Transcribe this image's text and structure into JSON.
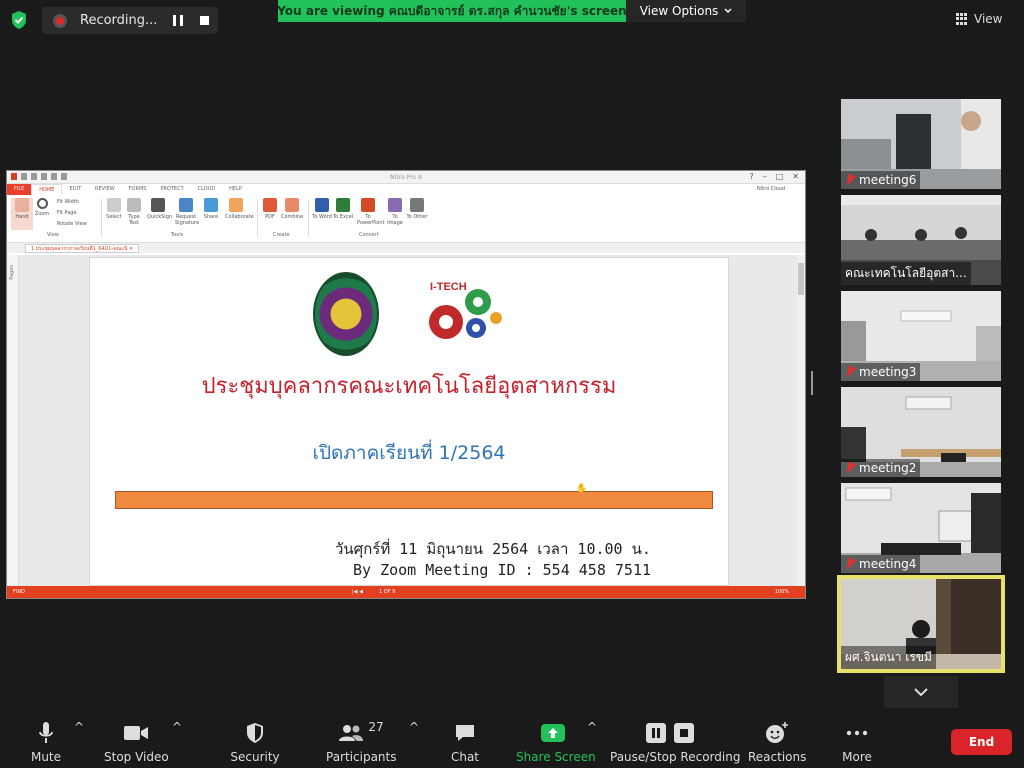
{
  "top": {
    "recording_label": "Recording...",
    "viewing_banner": "You are viewing คณบดีอาจารย์ ดร.สกุล คำนวนชัย's screen",
    "view_options_label": "View Options",
    "view_label": "View"
  },
  "nitro": {
    "window_title": "Nitro Pro 9",
    "tabs": [
      "FILE",
      "HOME",
      "EDIT",
      "REVIEW",
      "FORMS",
      "PROTECT",
      "CLOUD",
      "HELP"
    ],
    "cloud_label": "Nitro Cloud",
    "ribbon": {
      "hand": "Hand",
      "zoom": "Zoom",
      "fit_width": "Fit Width",
      "fit_page": "Fit Page",
      "rotate_view": "Rotate View",
      "view_group": "View",
      "select": "Select",
      "type_text": "Type Text",
      "quicksign": "QuickSign",
      "request_signature": "Request Signature",
      "share": "Share",
      "collaborate": "Collaborate",
      "tools_group": "Tools",
      "pdf": "PDF",
      "combine": "Combine",
      "create_group": "Create",
      "to_word": "To Word",
      "to_excel": "To Excel",
      "to_powerpoint": "To PowerPoint",
      "to_image": "To Image",
      "to_other": "To Other",
      "convert_group": "Convert"
    },
    "doc_tab": "1.ประชุมบุคลากรภาคเรียนที่1_64U1-คณะนี",
    "pages_rail": "Pages",
    "status": {
      "find": "FIND",
      "page_indicator": "1 OF 9",
      "zoom": "100%"
    }
  },
  "document": {
    "title": "ประชุมบุคลากรคณะเทคโนโลยีอุตสาหกรรม",
    "subtitle": "เปิดภาคเรียนที่ 1/2564",
    "date_line": "วันศุกร์ที่ 11 มิถุนายน 2564 เวลา 10.00 น.",
    "zoom_line": "By Zoom Meeting ID : 554 458 7511",
    "logo_text": "I-TECH"
  },
  "gallery": [
    {
      "name": "meeting6",
      "muted": true
    },
    {
      "name": "คณะเทคโนโลยีอุตสา...",
      "muted": false
    },
    {
      "name": "meeting3",
      "muted": true
    },
    {
      "name": "meeting2",
      "muted": true
    },
    {
      "name": "meeting4",
      "muted": true
    },
    {
      "name": "ผศ.จินตนา เรขมี",
      "muted": false
    }
  ],
  "toolbar": {
    "mute": "Mute",
    "stop_video": "Stop Video",
    "security": "Security",
    "participants": "Participants",
    "participants_count": "27",
    "chat": "Chat",
    "share_screen": "Share Screen",
    "pause_stop_recording": "Pause/Stop Recording",
    "reactions": "Reactions",
    "more": "More",
    "end": "End"
  },
  "colors": {
    "share_green": "#23c15a",
    "end_red": "#d9252a",
    "nitro_orange": "#e2401f",
    "active_speaker": "#e9e26a"
  }
}
